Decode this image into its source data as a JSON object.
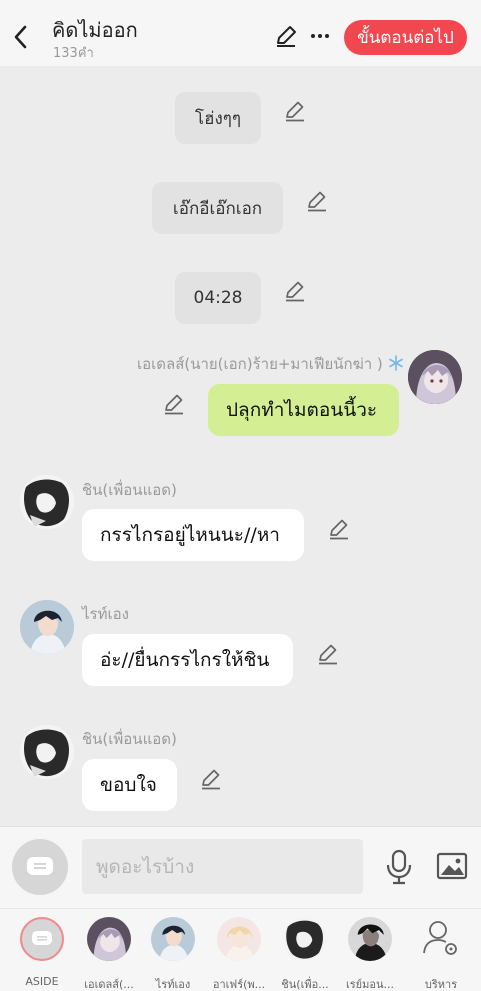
{
  "header": {
    "title": "คิดไม่ออก",
    "word_count": "133คำ",
    "next_label": "ขั้นตอนต่อไป"
  },
  "colors": {
    "accent": "#f2474f",
    "bubble_self": "#d3ee93",
    "bubble_other": "#ffffff",
    "narration": "#e2e2e2"
  },
  "messages": [
    {
      "type": "narration",
      "text": "โฮ่งๆๆ"
    },
    {
      "type": "narration",
      "text": "เอ๊กอีเอ๊กเอก"
    },
    {
      "type": "narration",
      "text": "04:28"
    },
    {
      "type": "self",
      "sender": "เอเดลส์(นาย(เอก)ร้าย+มาเฟียนักฆ่า )",
      "sender_badge": "snowflake-icon",
      "text": "ปลุกทำไมตอนนี้วะ"
    },
    {
      "type": "other",
      "sender": "ชิน(เพื่อนแอด)",
      "text": "กรรไกรอยู่ไหนนะ//หา"
    },
    {
      "type": "other",
      "sender": "ไรท์เอง",
      "text": "อ่ะ//ยื่นกรรไกรให้ชิน"
    },
    {
      "type": "other",
      "sender": "ชิน(เพื่อนแอด)",
      "text": "ขอบใจ"
    }
  ],
  "composer": {
    "placeholder": "พูดอะไรบ้าง"
  },
  "characters": [
    {
      "label": "ASIDE"
    },
    {
      "label": "เอเดลส์(..."
    },
    {
      "label": "ไรท์เอง"
    },
    {
      "label": "อาเฟร์(พ..."
    },
    {
      "label": "ชิน(เพื่อ..."
    },
    {
      "label": "เรย์มอน..."
    },
    {
      "label": "บริหาร"
    }
  ]
}
